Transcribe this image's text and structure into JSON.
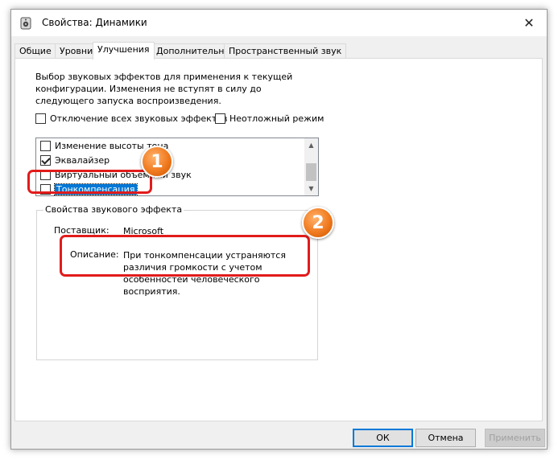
{
  "window": {
    "title": "Свойства: Динамики",
    "close_glyph": "✕"
  },
  "tabs": [
    {
      "label": "Общие",
      "active": false
    },
    {
      "label": "Уровни",
      "active": false
    },
    {
      "label": "Улучшения",
      "active": true
    },
    {
      "label": "Дополнительно",
      "active": false
    },
    {
      "label": "Пространственный звук",
      "active": false
    }
  ],
  "enhancements": {
    "description": "Выбор звуковых эффектов для применения к текущей конфигурации. Изменения не вступят в силу до следующего запуска воспроизведения.",
    "disable_all": {
      "label": "Отключение всех звуковых эффектов",
      "checked": false
    },
    "immediate_mode": {
      "label": "Неотложный режим",
      "checked": false
    },
    "effects": [
      {
        "label": "Изменение высоты тона",
        "checked": false
      },
      {
        "label": "Эквалайзер",
        "checked": true
      },
      {
        "label": "Виртуальный объемный звук",
        "checked": false
      },
      {
        "label": "Тонкомпенсация",
        "checked": false,
        "selected": true
      }
    ]
  },
  "properties": {
    "group_title": "Свойства звукового эффекта",
    "vendor_label": "Поставщик:",
    "vendor_value": "Microsoft",
    "description_label": "Описание:",
    "description_value": "При тонкомпенсации устраняются различия громкости с учетом особенностей человеческого восприятия."
  },
  "buttons": {
    "ok": "ОК",
    "cancel": "Отмена",
    "apply": "Применить"
  },
  "annotations": {
    "badge_1": "1",
    "badge_2": "2",
    "color": "#e21b1b"
  },
  "colors": {
    "accent": "#0078d7",
    "badge": "#f07a1f"
  }
}
